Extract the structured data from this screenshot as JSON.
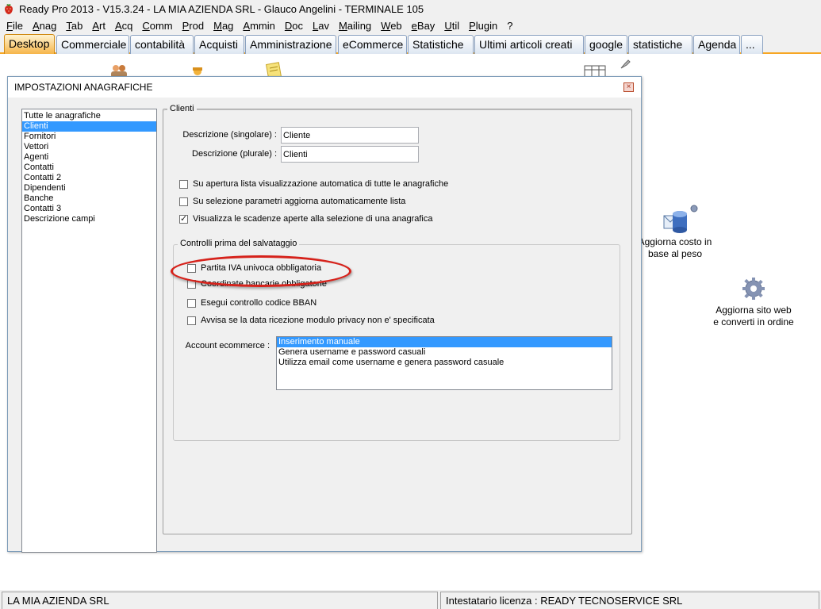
{
  "window": {
    "title": "Ready Pro 2013 - V15.3.24 - LA MIA AZIENDA SRL - Glauco Angelini - TERMINALE 105"
  },
  "menu": [
    {
      "label": "File",
      "ul": "F",
      "rest": "ile"
    },
    {
      "label": "Anag",
      "ul": "A",
      "rest": "nag"
    },
    {
      "label": "Tab",
      "ul": "T",
      "rest": "ab"
    },
    {
      "label": "Art",
      "ul": "A",
      "rest": "rt"
    },
    {
      "label": "Acq",
      "ul": "A",
      "rest": "cq"
    },
    {
      "label": "Comm",
      "ul": "C",
      "rest": "omm"
    },
    {
      "label": "Prod",
      "ul": "P",
      "rest": "rod"
    },
    {
      "label": "Mag",
      "ul": "M",
      "rest": "ag"
    },
    {
      "label": "Ammin",
      "ul": "A",
      "rest": "mmin"
    },
    {
      "label": "Doc",
      "ul": "D",
      "rest": "oc"
    },
    {
      "label": "Lav",
      "ul": "L",
      "rest": "av"
    },
    {
      "label": "Mailing",
      "ul": "M",
      "rest": "ailing"
    },
    {
      "label": "Web",
      "ul": "W",
      "rest": "eb"
    },
    {
      "label": "eBay",
      "ul": "e",
      "rest": "Bay"
    },
    {
      "label": "Util",
      "ul": "U",
      "rest": "til"
    },
    {
      "label": "Plugin",
      "ul": "P",
      "rest": "lugin"
    },
    {
      "label": "?",
      "ul": "",
      "rest": "?"
    }
  ],
  "tabs": [
    {
      "label": "Desktop",
      "active": true
    },
    {
      "label": "Commerciale"
    },
    {
      "label": "contabilità"
    },
    {
      "label": "Acquisti"
    },
    {
      "label": "Amministrazione"
    },
    {
      "label": "eCommerce"
    },
    {
      "label": "Statistiche"
    },
    {
      "label": "Ultimi articoli creati"
    },
    {
      "label": "google"
    },
    {
      "label": "statistiche"
    },
    {
      "label": "Agenda"
    },
    {
      "label": "..."
    }
  ],
  "desktop": {
    "shortcut_costo": "Aggiorna costo in\nbase al peso",
    "shortcut_sito": "Aggiorna sito web\ne converti in ordine"
  },
  "dialog": {
    "title": "IMPOSTAZIONI ANAGRAFICHE",
    "close": "×",
    "left_items": [
      {
        "label": "Tutte le anagrafiche"
      },
      {
        "label": "Clienti",
        "selected": true
      },
      {
        "label": "Fornitori"
      },
      {
        "label": "Vettori"
      },
      {
        "label": "Agenti"
      },
      {
        "label": "Contatti"
      },
      {
        "label": "Contatti 2"
      },
      {
        "label": "Dipendenti"
      },
      {
        "label": "Banche"
      },
      {
        "label": "Contatti 3"
      },
      {
        "label": "Descrizione campi"
      }
    ],
    "group_main": "Clienti",
    "desc_singolare_label": "Descrizione (singolare) :",
    "desc_singolare_value": "Cliente",
    "desc_plurale_label": "Descrizione (plurale) :",
    "desc_plurale_value": "Clienti",
    "checks_main": [
      {
        "label": "Su apertura lista visualizzazione automatica di tutte le anagrafiche",
        "checked": false
      },
      {
        "label": "Su selezione parametri aggiorna automaticamente lista",
        "checked": false
      },
      {
        "label": "Visualizza le scadenze aperte alla selezione di una anagrafica",
        "checked": true
      }
    ],
    "group_controlli": "Controlli prima del salvataggio",
    "checks_controlli": [
      {
        "label": "Partita IVA univoca obbligatoria",
        "checked": false
      },
      {
        "label": "Coordinate bancarie obbligatorie",
        "checked": false
      },
      {
        "label": "Esegui controllo codice BBAN",
        "checked": false
      },
      {
        "label": "Avvisa se la data ricezione modulo privacy non e' specificata",
        "checked": false
      }
    ],
    "account_label": "Account ecommerce :",
    "account_options": [
      {
        "label": "Inserimento manuale",
        "selected": true
      },
      {
        "label": "Genera username e password casuali"
      },
      {
        "label": "Utilizza email come username e genera password casuale"
      }
    ]
  },
  "status": {
    "company": "LA MIA AZIENDA SRL",
    "license": "Intestatario licenza : READY TECNOSERVICE SRL"
  },
  "colors": {
    "accent_tab": "#f7a623",
    "selection": "#3399ff",
    "highlight": "#d6221b"
  }
}
